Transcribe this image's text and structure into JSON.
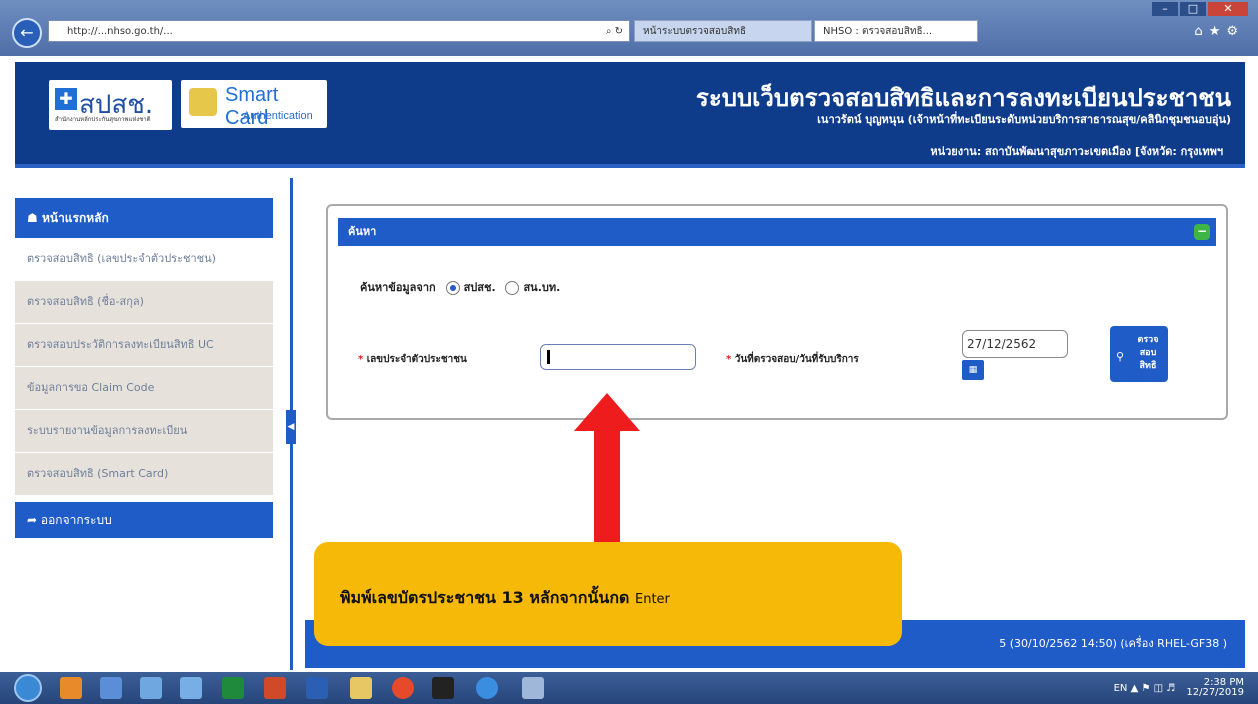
{
  "browser": {
    "address": "http://...nhso.go.th/...",
    "tabs": [
      {
        "label": "หน้าระบบตรวจสอบสิทธิ"
      },
      {
        "label": "NHSO : ตรวจสอบสิทธิ..."
      }
    ]
  },
  "header": {
    "logo_text": "สปสช.",
    "logo_sub": "สำนักงานหลักประกันสุขภาพแห่งชาติ",
    "smartcard_title": "Smart Card",
    "smartcard_sub": "Authentication",
    "site_title": "ระบบเว็บตรวจสอบสิทธิและการลงทะเบียนประชาชน",
    "user_line": "เนาวรัตน์ บุญหนุน (เจ้าหน้าที่ทะเบียนระดับหน่วยบริการสาธารณสุข/คลินิกชุมชนอบอุ่น)",
    "unit_line": "หน่วยงาน: สถาบันพัฒนาสุขภาวะเขตเมือง [จังหวัด: กรุงเทพฯ"
  },
  "sidebar": {
    "home": "หน้าแรกหลัก",
    "items": [
      {
        "label": "ตรวจสอบสิทธิ (เลขประจำตัวประชาชน)"
      },
      {
        "label": "ตรวจสอบสิทธิ (ชื่อ-สกุล)"
      },
      {
        "label": "ตรวจสอบประวัติการลงทะเบียนสิทธิ UC"
      },
      {
        "label": "ข้อมูลการขอ Claim Code"
      },
      {
        "label": "ระบบรายงานข้อมูลการลงทะเบียน"
      },
      {
        "label": "ตรวจสอบสิทธิ (Smart Card)"
      }
    ],
    "logout": "ออกจากระบบ"
  },
  "search": {
    "panel_title": "ค้นหา",
    "source_label": "ค้นหาข้อมูลจาก",
    "source_options": [
      {
        "label": "สปสช.",
        "selected": true
      },
      {
        "label": "สน.บท.",
        "selected": false
      }
    ],
    "required_mark": "*",
    "id_label": "เลขประจำตัวประชาชน",
    "id_value": "",
    "date_label": "วันที่ตรวจสอบ/วันที่รับบริการ",
    "date_value": "27/12/2562",
    "check_button": "ตรวจ สอบ สิทธิ"
  },
  "footer": {
    "text": "5 (30/10/2562 14:50) (เครื่อง RHEL-GF38 )"
  },
  "callout": {
    "text": "พิมพ์เลขบัตรประชาชน 13 หลักจากนั้นกด",
    "key": "Enter"
  },
  "taskbar": {
    "lang": "EN",
    "time": "2:38 PM",
    "date": "12/27/2019"
  },
  "colors": {
    "header_bg": "#0f3c8a",
    "accent": "#1f5cc8",
    "callout": "#f6b907",
    "arrow": "#ee1c1c"
  }
}
